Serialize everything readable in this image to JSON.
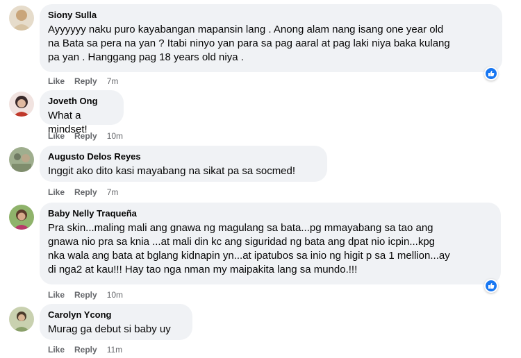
{
  "comments": [
    {
      "author": "Siony Sulla",
      "lines": [
        "Ayyyyyy naku puro kayabangan mapansin lang . Anong alam nang isang one year old",
        "na Bata sa pera na yan ? Itabi ninyo yan para sa pag aaral at pag laki niya baka kulang",
        "pa yan . Hanggang pag 18 years old niya ."
      ],
      "like_label": "Like",
      "reply_label": "Reply",
      "time": "7m",
      "has_reaction": true,
      "avatar_color": "#d9c9b0"
    },
    {
      "author": "Joveth Ong",
      "lines": [
        "What a mindset!"
      ],
      "like_label": "Like",
      "reply_label": "Reply",
      "time": "10m",
      "has_reaction": false,
      "avatar_color": "#c86a6a"
    },
    {
      "author": "Augusto Delos Reyes",
      "lines": [
        "Inggit ako dito kasi mayabang na sikat pa sa socmed!"
      ],
      "like_label": "Like",
      "reply_label": "Reply",
      "time": "7m",
      "has_reaction": false,
      "avatar_color": "#8a9a7a"
    },
    {
      "author": "Baby Nelly Traqueña",
      "lines": [
        "Pra skin...maling mali ang gnawa ng magulang sa bata...pg mmayabang sa tao ang",
        "gnawa nio pra sa knia ...at mali din kc ang siguridad ng bata ang dpat nio icpin...kpg",
        "nka wala ang bata at bglang kidnapin yn...at ipatubos sa inio ng higit p sa 1 mellion...ay",
        "di nga2 at kau!!! Hay tao nga nman my maipakita lang sa mundo.!!!"
      ],
      "like_label": "Like",
      "reply_label": "Reply",
      "time": "10m",
      "has_reaction": true,
      "avatar_color": "#7aa060"
    },
    {
      "author": "Carolyn Ycong",
      "lines": [
        "Murag ga debut si baby uy"
      ],
      "like_label": "Like",
      "reply_label": "Reply",
      "time": "11m",
      "has_reaction": false,
      "avatar_color": "#a8b48c"
    }
  ],
  "colors": {
    "bubble": "#f0f2f5",
    "meta": "#65676b",
    "like_blue": "#1877f2"
  }
}
